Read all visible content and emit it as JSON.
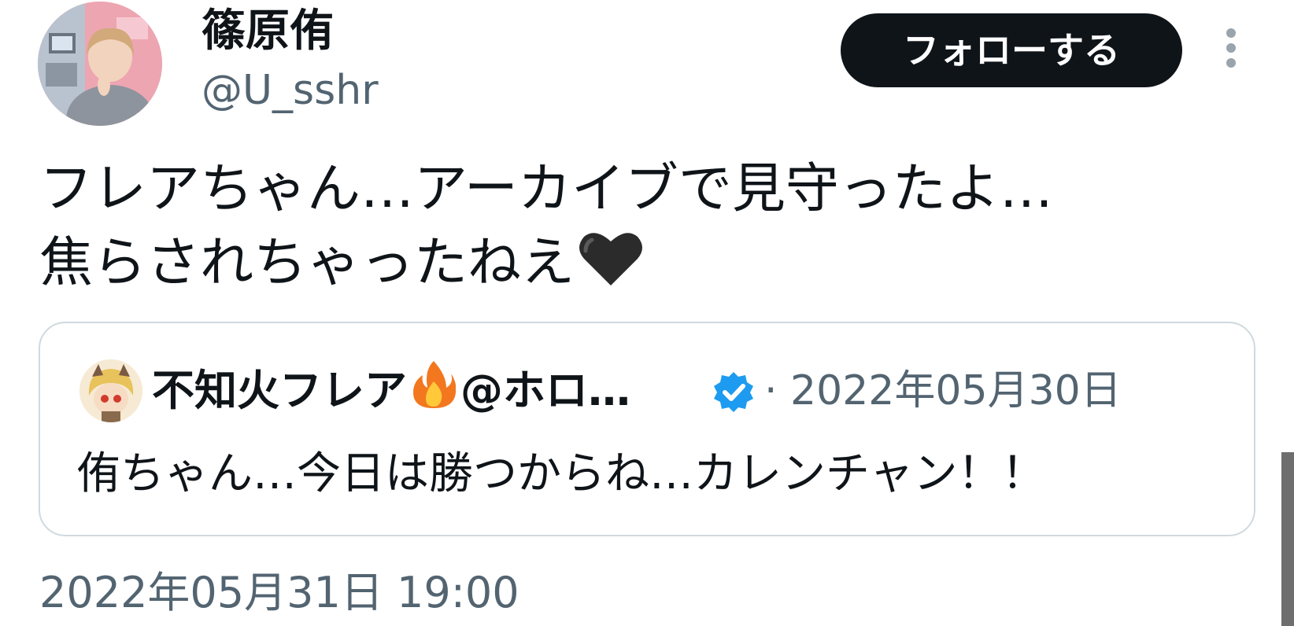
{
  "author": {
    "display_name": "篠原侑",
    "handle": "@U_sshr",
    "avatar_icon": "user-avatar-photo"
  },
  "actions": {
    "follow_label": "フォローする",
    "more_icon": "more-vertical-icon"
  },
  "tweet": {
    "text_line1": "フレアちゃん…アーカイブで見守ったよ…",
    "text_line2": "焦らされちゃったねえ",
    "emoji": "black-heart-icon",
    "timestamp": "2022年05月31日 19:00"
  },
  "quoted_tweet": {
    "display_name": "不知火フレア",
    "emoji": "fire-icon",
    "handle_truncated": "@ホロ…",
    "verified_icon": "verified-badge-icon",
    "date": "· 2022年05月30日",
    "text": "侑ちゃん…今日は勝つからね…カレンチャン！！"
  },
  "colors": {
    "text_primary": "#0f1419",
    "text_secondary": "#536471",
    "follow_button_bg": "#0f1419",
    "border": "#cfd9de",
    "verified_blue": "#1d9bf0"
  }
}
